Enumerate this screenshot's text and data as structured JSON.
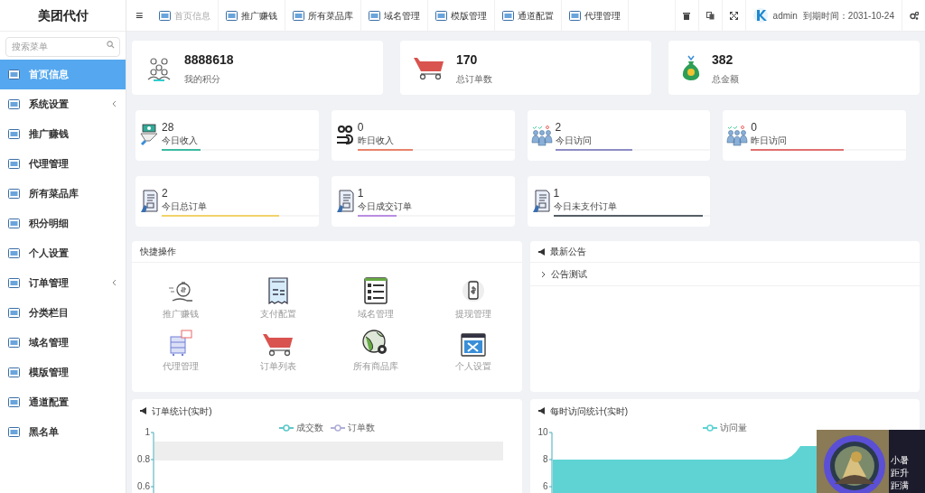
{
  "brand": "美团代付",
  "sidebar": {
    "search": {
      "placeholder": "搜索菜单"
    },
    "items": [
      {
        "label": "首页信息",
        "selected": true,
        "expandable": false
      },
      {
        "label": "系统设置",
        "selected": false,
        "expandable": true
      },
      {
        "label": "推广赚钱",
        "selected": false,
        "expandable": false
      },
      {
        "label": "代理管理",
        "selected": false,
        "expandable": false
      },
      {
        "label": "所有菜品库",
        "selected": false,
        "expandable": false
      },
      {
        "label": "积分明细",
        "selected": false,
        "expandable": false
      },
      {
        "label": "个人设置",
        "selected": false,
        "expandable": false
      },
      {
        "label": "订单管理",
        "selected": false,
        "expandable": true
      },
      {
        "label": "分类栏目",
        "selected": false,
        "expandable": false
      },
      {
        "label": "域名管理",
        "selected": false,
        "expandable": false
      },
      {
        "label": "模版管理",
        "selected": false,
        "expandable": false
      },
      {
        "label": "通道配置",
        "selected": false,
        "expandable": false
      },
      {
        "label": "黑名单",
        "selected": false,
        "expandable": false
      }
    ]
  },
  "top_tabs": [
    {
      "label": "首页信息",
      "selected": true
    },
    {
      "label": "推广赚钱",
      "selected": false
    },
    {
      "label": "所有菜品库",
      "selected": false
    },
    {
      "label": "域名管理",
      "selected": false
    },
    {
      "label": "模版管理",
      "selected": false
    },
    {
      "label": "通道配置",
      "selected": false
    },
    {
      "label": "代理管理",
      "selected": false
    }
  ],
  "menu_icon": "≡",
  "user": {
    "name": "admin",
    "expiry": "到期时间：2031-10-24"
  },
  "summary_cards": [
    {
      "value": "8888618",
      "label": "我的积分",
      "kind": "people"
    },
    {
      "value": "170",
      "label": "总订单数",
      "kind": "cart"
    },
    {
      "value": "382",
      "label": "总金额",
      "kind": "money"
    }
  ],
  "stat_cards": [
    {
      "value": "28",
      "label": "今日收入",
      "level": 0.25,
      "color": "#3cbaa0",
      "kind": "income"
    },
    {
      "value": "0",
      "label": "昨日收入",
      "level": 0.35,
      "color": "#e8836b",
      "kind": "coins"
    },
    {
      "value": "2",
      "label": "今日访问",
      "level": 0.5,
      "color": "#8e8cc4",
      "kind": "visit"
    },
    {
      "value": "0",
      "label": "昨日访问",
      "level": 0.6,
      "color": "#e07070",
      "kind": "visit"
    },
    {
      "value": "2",
      "label": "今日总订单",
      "level": 0.75,
      "color": "#f2d36b",
      "kind": "order"
    },
    {
      "value": "1",
      "label": "今日成交订单",
      "level": 0.25,
      "color": "#b98ee0",
      "kind": "order"
    },
    {
      "value": "1",
      "label": "今日未支付订单",
      "level": 0.95,
      "color": "#555e66",
      "kind": "order"
    }
  ],
  "quick_actions": {
    "title": "快捷操作",
    "items": [
      {
        "label": "推广赚钱",
        "kind": "moneybag"
      },
      {
        "label": "支付配置",
        "kind": "receipt"
      },
      {
        "label": "域名管理",
        "kind": "domain"
      },
      {
        "label": "提现管理",
        "kind": "phone"
      },
      {
        "label": "代理管理",
        "kind": "server"
      },
      {
        "label": "订单列表",
        "kind": "cart"
      },
      {
        "label": "所有商品库",
        "kind": "globe"
      },
      {
        "label": "个人设置",
        "kind": "tools"
      }
    ]
  },
  "announcements": {
    "title": "最新公告",
    "items": [
      {
        "label": "公告测试"
      }
    ]
  },
  "order_chart": {
    "title": "订单统计(实时)",
    "legend": [
      {
        "name": "成交数",
        "color": "#5fc9c9"
      },
      {
        "name": "订单数",
        "color": "#b0b0d8"
      }
    ],
    "y_ticks": [
      "1",
      "0.8",
      "0.6"
    ]
  },
  "visit_chart": {
    "title": "每时访问统计(实时)",
    "legend": [
      {
        "name": "访问量",
        "color": "#5fd3d3"
      }
    ],
    "y_ticks": [
      "10",
      "8",
      "6"
    ]
  },
  "floating_widget": {
    "lines": [
      "小暑",
      "距升",
      "距满"
    ]
  }
}
